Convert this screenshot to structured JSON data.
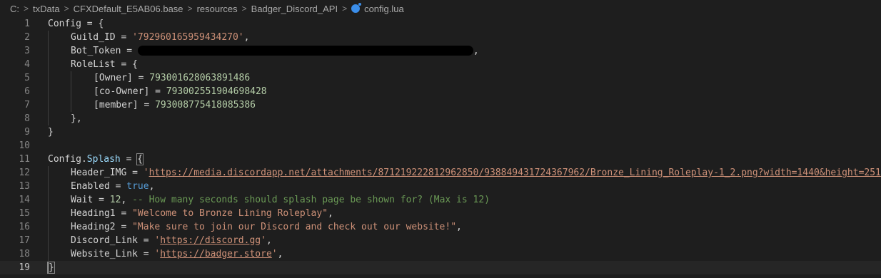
{
  "breadcrumbs": [
    "C:",
    "txData",
    "CFXDefault_E5AB06.base",
    "resources",
    "Badger_Discord_API"
  ],
  "file": {
    "icon": "lua-file-icon",
    "name": "config.lua"
  },
  "lines": {
    "l1": "Config = {",
    "l2a": "Guild_ID = ",
    "l2b": "'792960165959434270'",
    "l2c": ",",
    "l3a": "Bot_Token = ",
    "l3c": ",",
    "l4": "RoleList = {",
    "l5a": "[Owner] = ",
    "l5b": "793001628063891486",
    "l6a": "[co-Owner] = ",
    "l6b": "793002551904698428",
    "l7a": "[member] = ",
    "l7b": "793008775418085386",
    "l8": "},",
    "l9": "}",
    "l11a": "Config.",
    "l11b": "Splash",
    "l11c": " = ",
    "l11d": "{",
    "l12a": "Header_IMG = ",
    "l12q1": "'",
    "l12b": "https://media.discordapp.net/attachments/871219222812962850/938849431724367962/Bronze_Lining_Roleplay-1_2.png?width=1440&height=251",
    "l12q2": "'",
    "l12c": ",",
    "l13a": "Enabled = ",
    "l13b": "true",
    "l13c": ",",
    "l14a": "Wait = ",
    "l14b": "12",
    "l14c": ", ",
    "l14d": "-- How many seconds should splash page be shown for? (Max is 12)",
    "l15a": "Heading1 = ",
    "l15b": "\"Welcome to Bronze Lining Roleplay\"",
    "l15c": ",",
    "l16a": "Heading2 = ",
    "l16b": "\"Make sure to join our Discord and check out our website!\"",
    "l16c": ",",
    "l17a": "Discord_Link = ",
    "l17q1": "'",
    "l17b": "https://discord.gg",
    "l17q2": "'",
    "l17c": ",",
    "l18a": "Website_Link = ",
    "l18q1": "'",
    "l18b": "https://badger.store",
    "l18q2": "'",
    "l18c": ",",
    "l19": "}"
  },
  "line_numbers": [
    "1",
    "2",
    "3",
    "4",
    "5",
    "6",
    "7",
    "8",
    "9",
    "10",
    "11",
    "12",
    "13",
    "14",
    "15",
    "16",
    "17",
    "18",
    "19"
  ],
  "current_line": 19
}
